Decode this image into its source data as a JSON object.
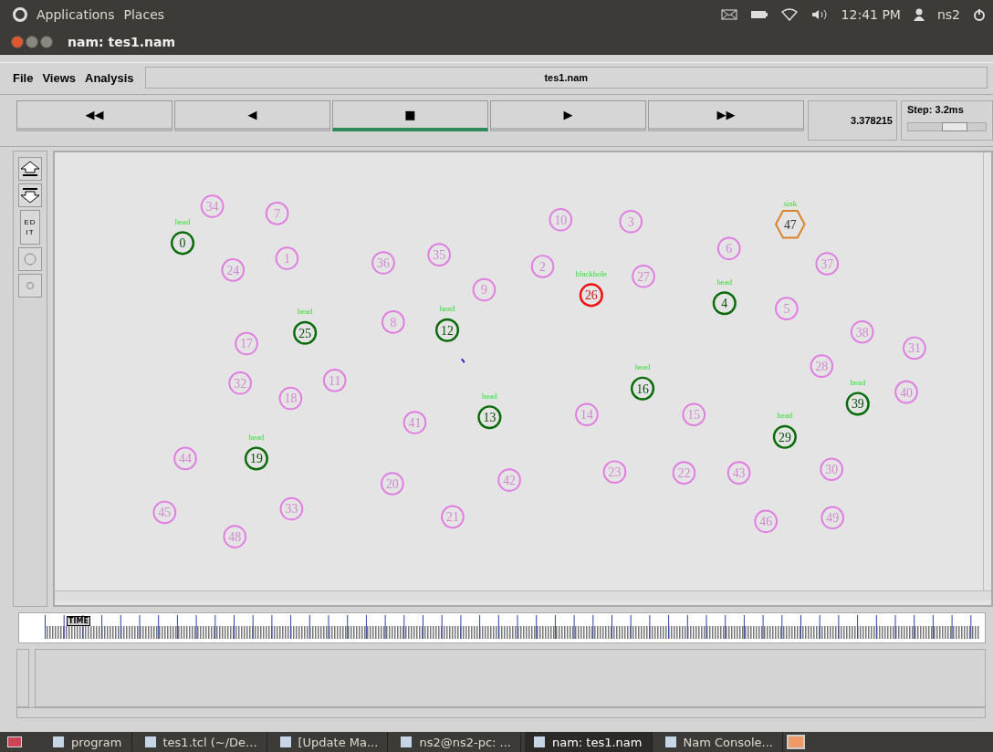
{
  "top_panel": {
    "menus": [
      "Applications",
      "Places"
    ],
    "clock": "12:41 PM",
    "user": "ns2"
  },
  "window": {
    "title": "nam: tes1.nam"
  },
  "menu_bar": {
    "items": [
      "File",
      "Views",
      "Analysis"
    ],
    "file_name": "tes1.nam"
  },
  "playback": {
    "buttons": [
      {
        "symbol": "◀◀",
        "selected": false
      },
      {
        "symbol": "◀",
        "selected": false
      },
      {
        "symbol": "■",
        "selected": true
      },
      {
        "symbol": "▶",
        "selected": false
      },
      {
        "symbol": "▶▶",
        "selected": false
      }
    ],
    "time": "3.378215",
    "step": "Step: 3.2ms",
    "step_slider": {
      "level": 0.6
    }
  },
  "edit_tool": {
    "label": "ED IT"
  },
  "nodes": [
    {
      "number": "0",
      "kind": "head",
      "label": "head"
    },
    {
      "number": "1",
      "kind": "normal"
    },
    {
      "number": "2",
      "kind": "normal"
    },
    {
      "number": "3",
      "kind": "normal"
    },
    {
      "number": "4",
      "kind": "head",
      "label": "head"
    },
    {
      "number": "5",
      "kind": "normal"
    },
    {
      "number": "6",
      "kind": "normal"
    },
    {
      "number": "7",
      "kind": "normal"
    },
    {
      "number": "8",
      "kind": "normal"
    },
    {
      "number": "9",
      "kind": "normal"
    },
    {
      "number": "10",
      "kind": "normal"
    },
    {
      "number": "11",
      "kind": "normal"
    },
    {
      "number": "12",
      "kind": "head",
      "label": "head"
    },
    {
      "number": "13",
      "kind": "head",
      "label": "head"
    },
    {
      "number": "14",
      "kind": "normal"
    },
    {
      "number": "15",
      "kind": "normal"
    },
    {
      "number": "16",
      "kind": "head",
      "label": "head"
    },
    {
      "number": "17",
      "kind": "normal"
    },
    {
      "number": "18",
      "kind": "normal"
    },
    {
      "number": "19",
      "kind": "head",
      "label": "head"
    },
    {
      "number": "20",
      "kind": "normal"
    },
    {
      "number": "21",
      "kind": "normal"
    },
    {
      "number": "23",
      "kind": "normal"
    },
    {
      "number": "22",
      "kind": "normal"
    },
    {
      "number": "24",
      "kind": "normal"
    },
    {
      "number": "25",
      "kind": "head",
      "label": "head"
    },
    {
      "number": "26",
      "kind": "blackhole",
      "label": "blackhole"
    },
    {
      "number": "27",
      "kind": "normal"
    },
    {
      "number": "28",
      "kind": "normal"
    },
    {
      "number": "29",
      "kind": "head",
      "label": "head"
    },
    {
      "number": "30",
      "kind": "normal"
    },
    {
      "number": "31",
      "kind": "normal"
    },
    {
      "number": "32",
      "kind": "normal"
    },
    {
      "number": "33",
      "kind": "normal"
    },
    {
      "number": "34",
      "kind": "normal"
    },
    {
      "number": "35",
      "kind": "normal"
    },
    {
      "number": "36",
      "kind": "normal"
    },
    {
      "number": "37",
      "kind": "normal"
    },
    {
      "number": "38",
      "kind": "normal"
    },
    {
      "number": "39",
      "kind": "head",
      "label": "head"
    },
    {
      "number": "40",
      "kind": "normal"
    },
    {
      "number": "41",
      "kind": "normal"
    },
    {
      "number": "42",
      "kind": "normal"
    },
    {
      "number": "43",
      "kind": "normal"
    },
    {
      "number": "44",
      "kind": "normal"
    },
    {
      "number": "45",
      "kind": "normal"
    },
    {
      "number": "46",
      "kind": "normal"
    },
    {
      "number": "47",
      "kind": "sink",
      "label": "sink"
    },
    {
      "number": "48",
      "kind": "normal"
    },
    {
      "number": "49",
      "kind": "normal"
    }
  ],
  "timeline": {
    "label": "TIME"
  },
  "taskbar": [
    {
      "label": "program",
      "selected": false
    },
    {
      "label": "tes1.tcl (~/De...",
      "selected": false
    },
    {
      "label": "[Update Ma...",
      "selected": false
    },
    {
      "label": "ns2@ns2-pc: ...",
      "selected": false
    },
    {
      "label": "nam: tes1.nam",
      "selected": true
    },
    {
      "label": "Nam Console...",
      "selected": false
    }
  ]
}
